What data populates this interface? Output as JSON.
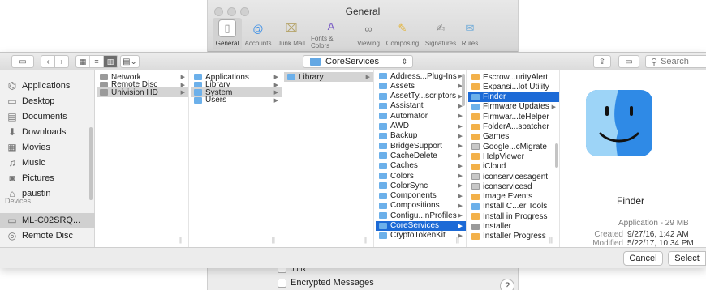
{
  "prefs_window": {
    "title": "General",
    "tabs": [
      {
        "label": "General",
        "icon": "switch-icon",
        "color": "#8b8b8b"
      },
      {
        "label": "Accounts",
        "icon": "at-sign-icon",
        "color": "#3a8ee6"
      },
      {
        "label": "Junk Mail",
        "icon": "trash-bin-icon",
        "color": "#b5a46a"
      },
      {
        "label": "Fonts & Colors",
        "icon": "font-icon",
        "color": "#7a5cc5"
      },
      {
        "label": "Viewing",
        "icon": "glasses-icon",
        "color": "#7d7d7d"
      },
      {
        "label": "Composing",
        "icon": "pencil-icon",
        "color": "#e3b232"
      },
      {
        "label": "Signatures",
        "icon": "signature-icon",
        "color": "#8a8a8a"
      },
      {
        "label": "Rules",
        "icon": "rules-icon",
        "color": "#6aa8d8"
      }
    ],
    "mailbox_rows": [
      "Junk",
      "Encrypted Messages"
    ],
    "help": "?"
  },
  "toolbar": {
    "location": "CoreServices",
    "search_placeholder": "Search"
  },
  "sidebar": {
    "favorites": [
      {
        "label": "Applications",
        "icon": "applications-icon"
      },
      {
        "label": "Desktop",
        "icon": "desktop-icon"
      },
      {
        "label": "Documents",
        "icon": "documents-icon"
      },
      {
        "label": "Downloads",
        "icon": "downloads-icon"
      },
      {
        "label": "Movies",
        "icon": "movies-icon"
      },
      {
        "label": "Music",
        "icon": "music-icon"
      },
      {
        "label": "Pictures",
        "icon": "pictures-icon"
      },
      {
        "label": "paustin",
        "icon": "home-icon"
      }
    ],
    "devices_header": "Devices",
    "devices": [
      {
        "label": "ML-C02SRQ...",
        "icon": "laptop-icon"
      },
      {
        "label": "Remote Disc",
        "icon": "remote-disc-icon"
      }
    ]
  },
  "columns": [
    {
      "items": [
        {
          "label": "Network",
          "icon": "network-icon",
          "arrow": true
        },
        {
          "label": "Remote Disc",
          "icon": "remote-disc-icon",
          "arrow": true
        },
        {
          "label": "Univision HD",
          "icon": "drive-icon",
          "arrow": true,
          "selected": "gray"
        }
      ]
    },
    {
      "items": [
        {
          "label": "Applications",
          "icon": "folder-icon",
          "arrow": true
        },
        {
          "label": "Library",
          "icon": "folder-icon",
          "arrow": true
        },
        {
          "label": "System",
          "icon": "folder-icon",
          "arrow": true,
          "selected": "gray"
        },
        {
          "label": "Users",
          "icon": "folder-icon",
          "arrow": true
        }
      ]
    },
    {
      "items": [
        {
          "label": "Library",
          "icon": "folder-icon",
          "arrow": true,
          "selected": "gray"
        }
      ]
    },
    {
      "items": [
        {
          "label": "Address...Plug-Ins",
          "icon": "folder-icon",
          "arrow": true
        },
        {
          "label": "Assets",
          "icon": "folder-icon",
          "arrow": true
        },
        {
          "label": "AssetTy...scriptors",
          "icon": "folder-icon",
          "arrow": true
        },
        {
          "label": "Assistant",
          "icon": "folder-icon",
          "arrow": true
        },
        {
          "label": "Automator",
          "icon": "folder-icon",
          "arrow": true
        },
        {
          "label": "AWD",
          "icon": "folder-icon",
          "arrow": true
        },
        {
          "label": "Backup",
          "icon": "folder-icon",
          "arrow": true
        },
        {
          "label": "BridgeSupport",
          "icon": "folder-icon",
          "arrow": true
        },
        {
          "label": "CacheDelete",
          "icon": "folder-icon",
          "arrow": true
        },
        {
          "label": "Caches",
          "icon": "folder-icon",
          "arrow": true
        },
        {
          "label": "Colors",
          "icon": "folder-icon",
          "arrow": true
        },
        {
          "label": "ColorSync",
          "icon": "folder-icon",
          "arrow": true
        },
        {
          "label": "Components",
          "icon": "folder-icon",
          "arrow": true
        },
        {
          "label": "Compositions",
          "icon": "folder-icon",
          "arrow": true
        },
        {
          "label": "Configu...nProfiles",
          "icon": "folder-icon",
          "arrow": true
        },
        {
          "label": "CoreServices",
          "icon": "folder-icon",
          "arrow": true,
          "selected": "blue"
        },
        {
          "label": "CryptoTokenKit",
          "icon": "folder-icon",
          "arrow": true
        }
      ]
    },
    {
      "items": [
        {
          "label": "Escrow...urityAlert",
          "icon": "app-icon",
          "arrow": false
        },
        {
          "label": "Expansi...lot Utility",
          "icon": "app-icon",
          "arrow": false
        },
        {
          "label": "Finder",
          "icon": "finder-icon",
          "arrow": false,
          "selected": "blue"
        },
        {
          "label": "Firmware Updates",
          "icon": "folder-icon",
          "arrow": true
        },
        {
          "label": "Firmwar...teHelper",
          "icon": "app-icon",
          "arrow": false
        },
        {
          "label": "FolderA...spatcher",
          "icon": "app-icon",
          "arrow": false
        },
        {
          "label": "Games",
          "icon": "games-icon",
          "arrow": false
        },
        {
          "label": "Google...cMigrate",
          "icon": "document-icon",
          "arrow": false
        },
        {
          "label": "HelpViewer",
          "icon": "help-viewer-icon",
          "arrow": false
        },
        {
          "label": "iCloud",
          "icon": "app-icon",
          "arrow": false
        },
        {
          "label": "iconservicesagent",
          "icon": "document-icon",
          "arrow": false
        },
        {
          "label": "iconservicesd",
          "icon": "document-icon",
          "arrow": false
        },
        {
          "label": "Image Events",
          "icon": "app-icon",
          "arrow": false
        },
        {
          "label": "Install C...er Tools",
          "icon": "install-icon",
          "arrow": false
        },
        {
          "label": "Install in Progress",
          "icon": "app-icon",
          "arrow": false
        },
        {
          "label": "Installer",
          "icon": "installer-icon",
          "arrow": false
        },
        {
          "label": "Installer Progress",
          "icon": "app-icon",
          "arrow": false
        }
      ]
    }
  ],
  "preview": {
    "name": "Finder",
    "kind": "Application - 29 MB",
    "created_label": "Created",
    "created": "9/27/16, 1:42 AM",
    "modified_label": "Modified",
    "modified": "5/22/17, 10:34 PM"
  },
  "buttons": {
    "cancel": "Cancel",
    "select": "Select"
  },
  "colors": {
    "selection_blue": "#1c6ad6",
    "folder_blue": "#6cb0ea",
    "finder_blue": "#2f8ae6"
  }
}
